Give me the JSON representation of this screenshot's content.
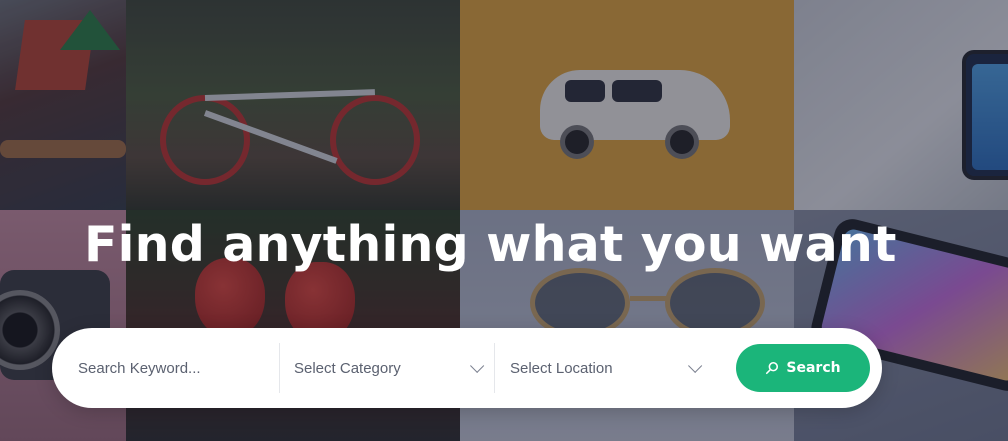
{
  "hero": {
    "headline": "Find anything what you want"
  },
  "search": {
    "keyword_placeholder": "Search Keyword...",
    "category_label": "Select Category",
    "location_label": "Select Location",
    "button_label": "Search",
    "button_icon": "search-icon",
    "accent_color": "#1bb57a"
  }
}
